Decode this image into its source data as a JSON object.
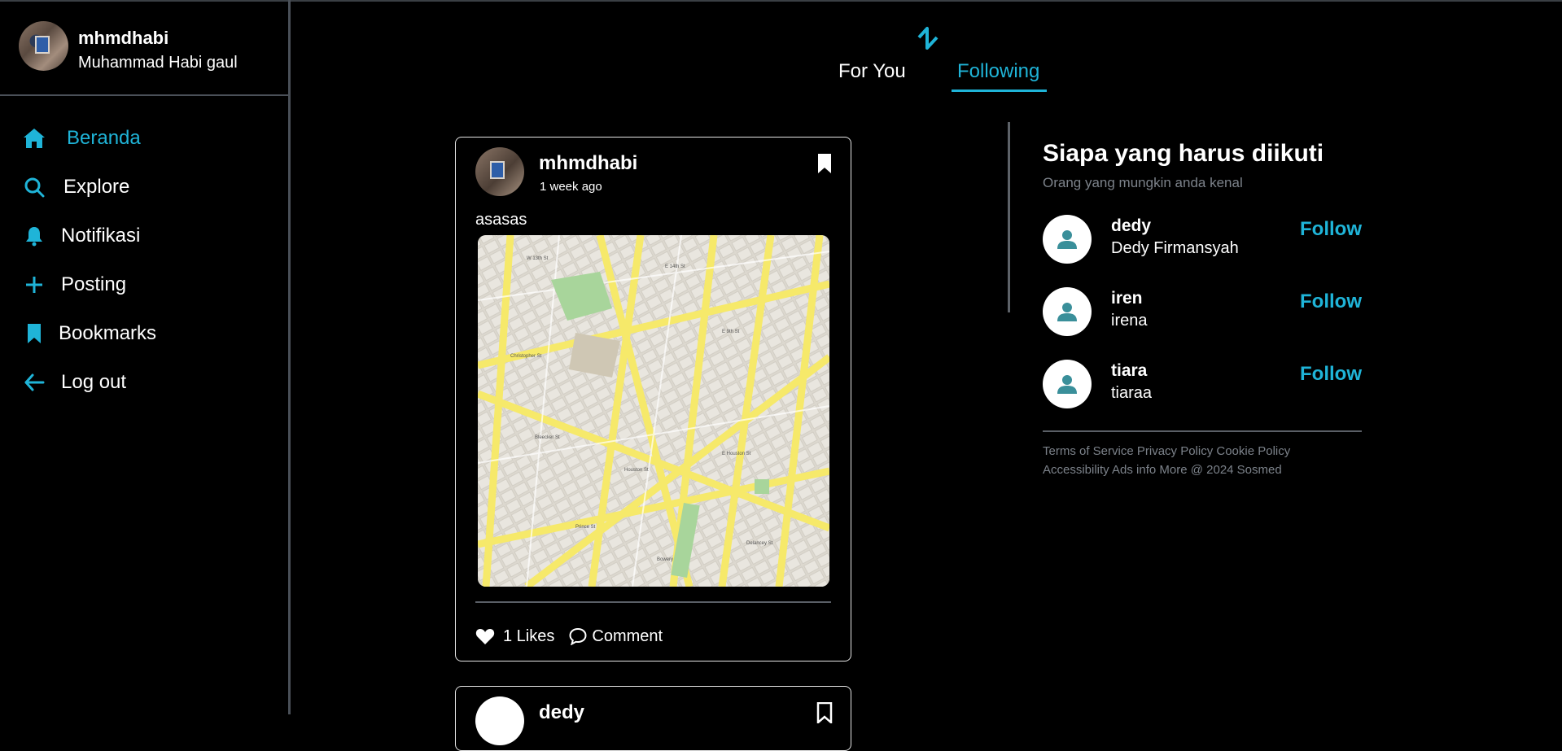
{
  "colors": {
    "accent": "#1fb4d8",
    "background": "#000000",
    "text": "#ffffff",
    "muted": "#7c828a"
  },
  "profile": {
    "username": "mhmdhabi",
    "fullname": "Muhammad Habi gaul"
  },
  "nav": {
    "items": [
      {
        "label": "Beranda",
        "icon": "home-icon",
        "active": true
      },
      {
        "label": "Explore",
        "icon": "search-icon"
      },
      {
        "label": "Notifikasi",
        "icon": "bell-icon"
      },
      {
        "label": "Posting",
        "icon": "plus-icon"
      },
      {
        "label": "Bookmarks",
        "icon": "bookmark-icon"
      },
      {
        "label": "Log out",
        "icon": "arrow-left-icon"
      }
    ]
  },
  "tabs": {
    "for_you": "For You",
    "following": "Following",
    "active": "following"
  },
  "post": {
    "username": "mhmdhabi",
    "time": "1 week ago",
    "text": "asasas",
    "image": "map-image",
    "likes": "1 Likes",
    "comment": "Comment"
  },
  "post2": {
    "username": "dedy"
  },
  "suggestions": {
    "title": "Siapa yang harus diikuti",
    "subtitle": "Orang yang mungkin anda kenal",
    "follow_label": "Follow",
    "users": [
      {
        "username": "dedy",
        "fullname": "Dedy Firmansyah"
      },
      {
        "username": "iren",
        "fullname": "irena"
      },
      {
        "username": "tiara",
        "fullname": "tiaraa"
      }
    ]
  },
  "footer": {
    "line1": "Terms of Service Privacy Policy Cookie Policy",
    "line2": "Accessibility Ads info More @ 2024 Sosmed"
  }
}
